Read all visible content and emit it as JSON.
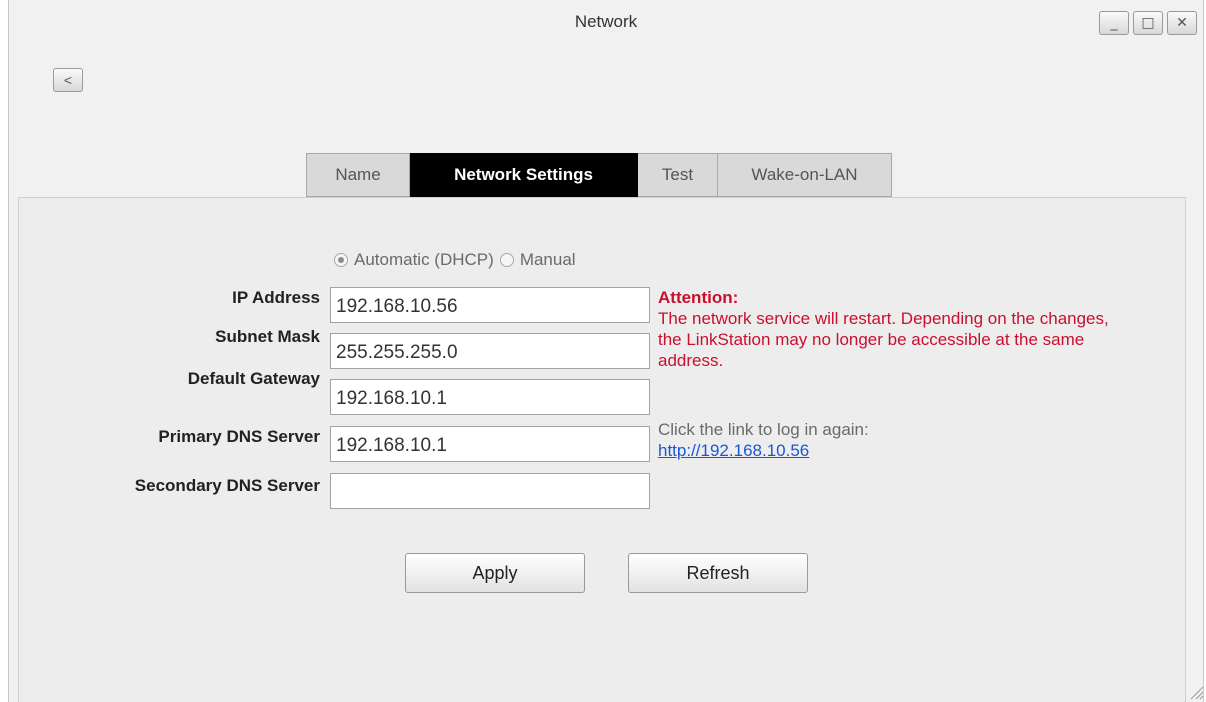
{
  "window": {
    "title": "Network",
    "controls": {
      "minimize": "_",
      "maximize": "□",
      "close": "✕"
    },
    "back_label": "<"
  },
  "tabs": [
    {
      "label": "Name",
      "active": false
    },
    {
      "label": "Network Settings",
      "active": true
    },
    {
      "label": "Test",
      "active": false
    },
    {
      "label": "Wake-on-LAN",
      "active": false
    }
  ],
  "mode": {
    "automatic_label": "Automatic (DHCP)",
    "manual_label": "Manual",
    "selected": "automatic"
  },
  "fields": {
    "ip_address": {
      "label": "IP Address",
      "value": "192.168.10.56"
    },
    "subnet_mask": {
      "label": "Subnet Mask",
      "value": "255.255.255.0"
    },
    "default_gateway": {
      "label": "Default Gateway",
      "value": "192.168.10.1"
    },
    "primary_dns": {
      "label": "Primary DNS Server",
      "value": "192.168.10.1"
    },
    "secondary_dns": {
      "label": "Secondary DNS Server",
      "value": ""
    }
  },
  "notice": {
    "heading": "Attention:",
    "body": "The network service will restart. Depending on the changes, the LinkStation may no longer be accessible at the same address.",
    "relogin_text": "Click the link to log in again:",
    "relogin_link": "http://192.168.10.56"
  },
  "actions": {
    "apply_label": "Apply",
    "refresh_label": "Refresh"
  },
  "colors": {
    "active_tab_bg": "#000000",
    "warning": "#c8102e",
    "link": "#1a57d4"
  },
  "icons": {
    "minimize": "minimize-icon",
    "maximize": "maximize-icon",
    "close": "close-icon",
    "back": "chevron-left-icon",
    "resize": "resize-grip-icon"
  }
}
